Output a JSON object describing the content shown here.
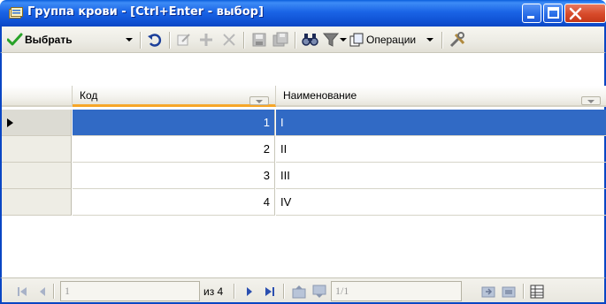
{
  "window": {
    "title": "Группа крови - [Ctrl+Enter - выбор]",
    "icon": "form-icon",
    "buttons": [
      "minimize-icon",
      "maximize-icon",
      "close-icon"
    ]
  },
  "toolbar": {
    "select_label": "Выбрать",
    "operations_label": "Операции",
    "icons": [
      "check-icon",
      "refresh-icon",
      "edit-icon",
      "add-icon",
      "delete-icon",
      "save-icon",
      "save-all-icon",
      "find-icon",
      "filter-icon",
      "copy-icon",
      "tools-icon"
    ]
  },
  "grid": {
    "columns": [
      "Код",
      "Наименование"
    ],
    "rows": [
      {
        "code": "1",
        "name": "I"
      },
      {
        "code": "2",
        "name": "II"
      },
      {
        "code": "3",
        "name": "III"
      },
      {
        "code": "4",
        "name": "IV"
      }
    ],
    "selected_index": 0
  },
  "navigator": {
    "record_value": "1",
    "of_total": "из 4",
    "page_value": "1/1"
  },
  "colors": {
    "title_bar": "#1a64e6",
    "selection": "#316ac5",
    "active_column": "#f6a628"
  }
}
